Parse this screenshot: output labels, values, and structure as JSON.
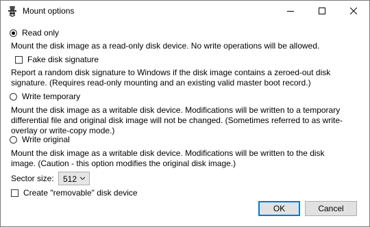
{
  "window": {
    "title": "Mount options",
    "icon": "app-icon"
  },
  "options": {
    "read_only": {
      "label": "Read only",
      "selected": true,
      "description": "Mount the disk image as a read-only disk device. No write operations will be allowed."
    },
    "fake_disk_signature": {
      "label": "Fake disk signature",
      "checked": false,
      "description_line1": "Report a random disk signature to Windows if the disk image contains a zeroed-out disk",
      "description_line2": "signature. (Requires read-only mounting and an existing valid master boot record.)"
    },
    "write_temporary": {
      "label": "Write temporary",
      "selected": false,
      "description_line1": "Mount the disk image as a writable disk device. Modifications will be written to a temporary",
      "description_line2": "differential file and original disk image will not be changed. (Sometimes referred to as write-",
      "description_line3": "overlay or write-copy mode.)"
    },
    "write_original": {
      "label": "Write original",
      "selected": false,
      "description_line1": "Mount the disk image as a writable disk device. Modifications will be written to the disk",
      "description_line2": "image. (Caution - this option modifies the original disk image.)"
    }
  },
  "sector_size": {
    "label": "Sector size:",
    "value": "512"
  },
  "removable": {
    "label": "Create \"removable\" disk device",
    "checked": false
  },
  "buttons": {
    "ok": "OK",
    "cancel": "Cancel"
  },
  "colors": {
    "accent": "#0078d7",
    "button_bg": "#e1e1e1"
  }
}
